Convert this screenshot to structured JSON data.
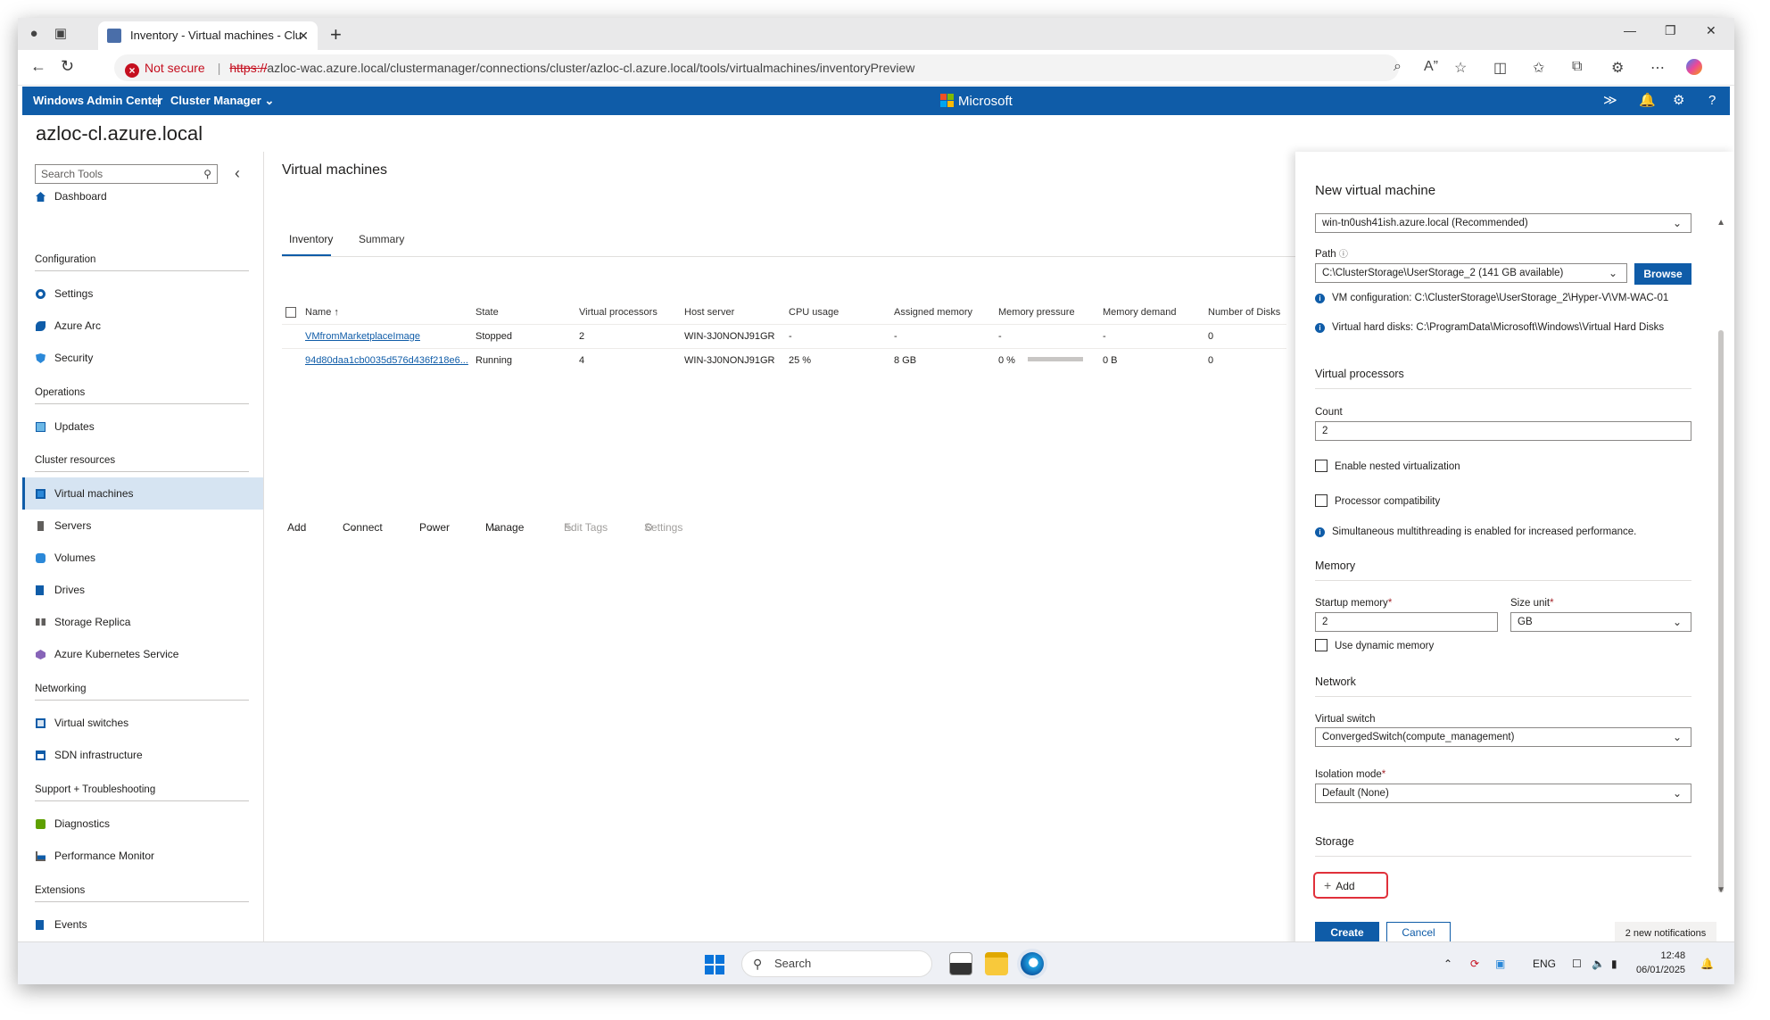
{
  "browser": {
    "tab_title": "Inventory - Virtual machines - Clu",
    "security_label": "Not secure",
    "url_scheme": "https://",
    "url_rest": "azloc-wac.azure.local/clustermanager/connections/cluster/azloc-cl.azure.local/tools/virtualmachines/inventoryPreview"
  },
  "header": {
    "app_name": "Windows Admin Center",
    "tool_switcher": "Cluster Manager",
    "brand": "Microsoft"
  },
  "connection_title": "azloc-cl.azure.local",
  "sidebar": {
    "search_placeholder": "Search Tools",
    "dashboard": "Dashboard",
    "sections": {
      "configuration": "Configuration",
      "operations": "Operations",
      "cluster_resources": "Cluster resources",
      "networking": "Networking",
      "support": "Support + Troubleshooting",
      "extensions": "Extensions"
    },
    "items": {
      "settings": "Settings",
      "azure_arc": "Azure Arc",
      "security": "Security",
      "updates": "Updates",
      "virtual_machines": "Virtual machines",
      "servers": "Servers",
      "volumes": "Volumes",
      "drives": "Drives",
      "storage_replica": "Storage Replica",
      "aks": "Azure Kubernetes Service",
      "virtual_switches": "Virtual switches",
      "sdn": "SDN infrastructure",
      "diagnostics": "Diagnostics",
      "perfmon": "Performance Monitor",
      "events": "Events"
    }
  },
  "main": {
    "title": "Virtual machines",
    "tabs": [
      "Inventory",
      "Summary"
    ],
    "commands": {
      "add": "Add",
      "connect": "Connect",
      "power": "Power",
      "manage": "Manage",
      "edit_tags": "Edit Tags",
      "settings": "Settings"
    },
    "columns": [
      "Name",
      "State",
      "Virtual processors",
      "Host server",
      "CPU usage",
      "Assigned memory",
      "Memory pressure",
      "Memory demand",
      "Number of Disks"
    ],
    "rows": [
      {
        "name": "VMfromMarketplaceImage",
        "state": "Stopped",
        "vcpu": "2",
        "host": "WIN-3J0NONJ91GR",
        "cpu": "-",
        "assigned": "-",
        "pressure": "-",
        "demand": "-",
        "disks": "0"
      },
      {
        "name": "94d80daa1cb0035d576d436f218e6...",
        "state": "Running",
        "vcpu": "4",
        "host": "WIN-3J0NONJ91GR",
        "cpu": "25 %",
        "assigned": "8 GB",
        "pressure": "0 %",
        "demand": "0 B",
        "disks": "0"
      }
    ]
  },
  "panel": {
    "title": "New virtual machine",
    "host_value": "win-tn0ush41ish.azure.local (Recommended)",
    "path_label": "Path",
    "path_value": "C:\\ClusterStorage\\UserStorage_2 (141 GB available)",
    "browse": "Browse",
    "vm_config": "VM configuration: C:\\ClusterStorage\\UserStorage_2\\Hyper-V\\VM-WAC-01",
    "vhd": "Virtual hard disks: C:\\ProgramData\\Microsoft\\Windows\\Virtual Hard Disks",
    "vp_section": "Virtual processors",
    "count_label": "Count",
    "count_value": "2",
    "nested_virt": "Enable nested virtualization",
    "proc_compat": "Processor compatibility",
    "smt_info": "Simultaneous multithreading is enabled for increased performance.",
    "memory_section": "Memory",
    "startup_memory_label": "Startup memory",
    "startup_memory_value": "2",
    "size_unit_label": "Size unit",
    "size_unit_value": "GB",
    "dynamic_memory": "Use dynamic memory",
    "network_section": "Network",
    "vswitch_label": "Virtual switch",
    "vswitch_value": "ConvergedSwitch(compute_management)",
    "isolation_label": "Isolation mode",
    "isolation_value": "Default (None)",
    "storage_section": "Storage",
    "add": "Add",
    "create": "Create",
    "cancel": "Cancel",
    "notifications": "2 new notifications"
  },
  "taskbar": {
    "search": "Search",
    "lang": "ENG",
    "time": "12:48",
    "date": "06/01/2025"
  }
}
